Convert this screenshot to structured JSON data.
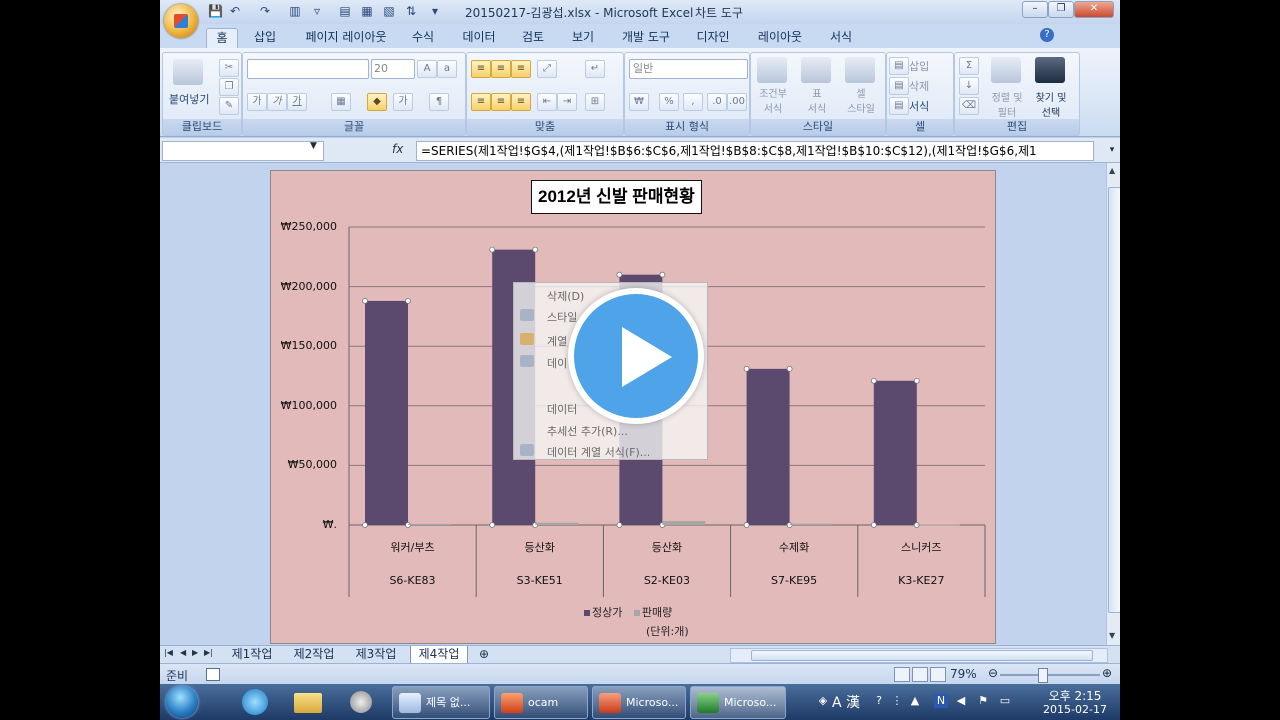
{
  "window": {
    "title": "20150217-김광섭.xlsx - Microsoft Excel",
    "context_title": "차트 도구",
    "minimize": "–",
    "restore": "❐",
    "close": "✕"
  },
  "tabs": [
    "홈",
    "삽입",
    "페이지 레이아웃",
    "수식",
    "데이터",
    "검토",
    "보기",
    "개발 도구",
    "디자인",
    "레이아웃",
    "서식"
  ],
  "ribbon": {
    "clipboard": {
      "label": "클립보드",
      "paste": "붙여넣기"
    },
    "font": {
      "label": "글꼴",
      "size": "20",
      "bold": "가",
      "italic": "가",
      "underline": "가",
      "fontcolor": "가"
    },
    "alignment": {
      "label": "맞춤"
    },
    "number": {
      "label": "표시 형식",
      "format": "일반",
      "currency": "₩",
      "percent": "%"
    },
    "styles": {
      "label": "스타일",
      "conditional": "조건부\n서식",
      "table": "표\n서식",
      "cell": "셀\n스타일"
    },
    "cells": {
      "label": "셀",
      "insert": "삽입",
      "delete": "삭제",
      "format": "서식"
    },
    "editing": {
      "label": "편집",
      "sort": "정렬 및\n필터",
      "find": "찾기 및\n선택"
    }
  },
  "formula_bar": {
    "fx": "fx",
    "formula": "=SERIES(제1작업!$G$4,(제1작업!$B$6:$C$6,제1작업!$B$8:$C$8,제1작업!$B$10:$C$12),(제1작업!$G$6,제1"
  },
  "chart_data": {
    "type": "bar",
    "title": "2012년 신발 판매현황",
    "categories": [
      "워커/부츠",
      "등산화",
      "등산화",
      "수제화",
      "스니커즈"
    ],
    "subcategories": [
      "S6-KE83",
      "S3-KE51",
      "S2-KE03",
      "S7-KE95",
      "K3-KE27"
    ],
    "series": [
      {
        "name": "정상가",
        "values": [
          188000,
          231000,
          210000,
          131000,
          121000
        ],
        "color": "#5b4a6e"
      },
      {
        "name": "판매량",
        "values": [
          900,
          1900,
          3300,
          1200,
          500
        ],
        "color": "#a6a6a6"
      }
    ],
    "ylim": [
      0,
      250000
    ],
    "yticks": [
      "₩.",
      "₩50,000",
      "₩100,000",
      "₩150,000",
      "₩200,000",
      "₩250,000"
    ],
    "grid": true,
    "legend": "bottom",
    "unit_note": "(단위:개)",
    "background": "#e3baba"
  },
  "context_menu": {
    "items": [
      "삭제(D)",
      "스타일",
      "계열",
      "데이",
      "",
      "데이터",
      "추세선 추가(R)...",
      "데이터 계열 서식(F)..."
    ]
  },
  "sheets": [
    "제1작업",
    "제2작업",
    "제3작업",
    "제4작업"
  ],
  "active_sheet": "제4작업",
  "status": {
    "ready": "준비",
    "zoom": "79%"
  },
  "taskbar": {
    "tasks": [
      "제목 없...",
      "ocam",
      "Microso...",
      "Microso..."
    ],
    "time": "오후 2:15",
    "date": "2015-02-17",
    "ime": "A 漢"
  }
}
